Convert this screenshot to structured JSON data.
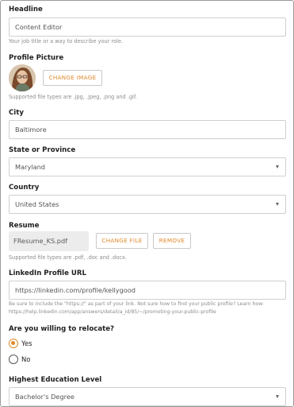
{
  "headline": {
    "label": "Headline",
    "value": "Content Editor",
    "help": "Your job title or a way to describe your role."
  },
  "profile_picture": {
    "label": "Profile Picture",
    "button": "CHANGE IMAGE",
    "help": "Supported file types are .jpg, .jpeg, .png and .gif."
  },
  "city": {
    "label": "City",
    "value": "Baltimore"
  },
  "state": {
    "label": "State or Province",
    "value": "Maryland"
  },
  "country": {
    "label": "Country",
    "value": "United States"
  },
  "resume": {
    "label": "Resume",
    "filename": "FResume_KS.pdf",
    "change_button": "CHANGE FILE",
    "remove_button": "REMOVE",
    "help": "Supported file types are .pdf, .doc and .docx."
  },
  "linkedin": {
    "label": "LinkedIn Profile URL",
    "value": "https://linkedin.com/profile/kellygood",
    "help_line1": "Be sure to include the \"https://\" as part of your link. Not sure how to find your public profile? Learn how:",
    "help_line2": "https://help.linkedin.com/app/answers/detail/a_id/85/~/promoting-your-public-profile"
  },
  "relocate": {
    "label": "Are you willing to relocate?",
    "options": [
      "Yes",
      "No"
    ],
    "selected": "Yes"
  },
  "education": {
    "label": "Highest Education Level",
    "value": "Bachelor's Degree"
  },
  "colors": {
    "accent": "#e08a2c",
    "border": "#cfcfcf",
    "help_text": "#8d8d8d"
  },
  "icons": {
    "select_caret": "caret-down-icon",
    "radio_selected": "radio-selected-icon",
    "radio_unselected": "radio-unselected-icon"
  }
}
